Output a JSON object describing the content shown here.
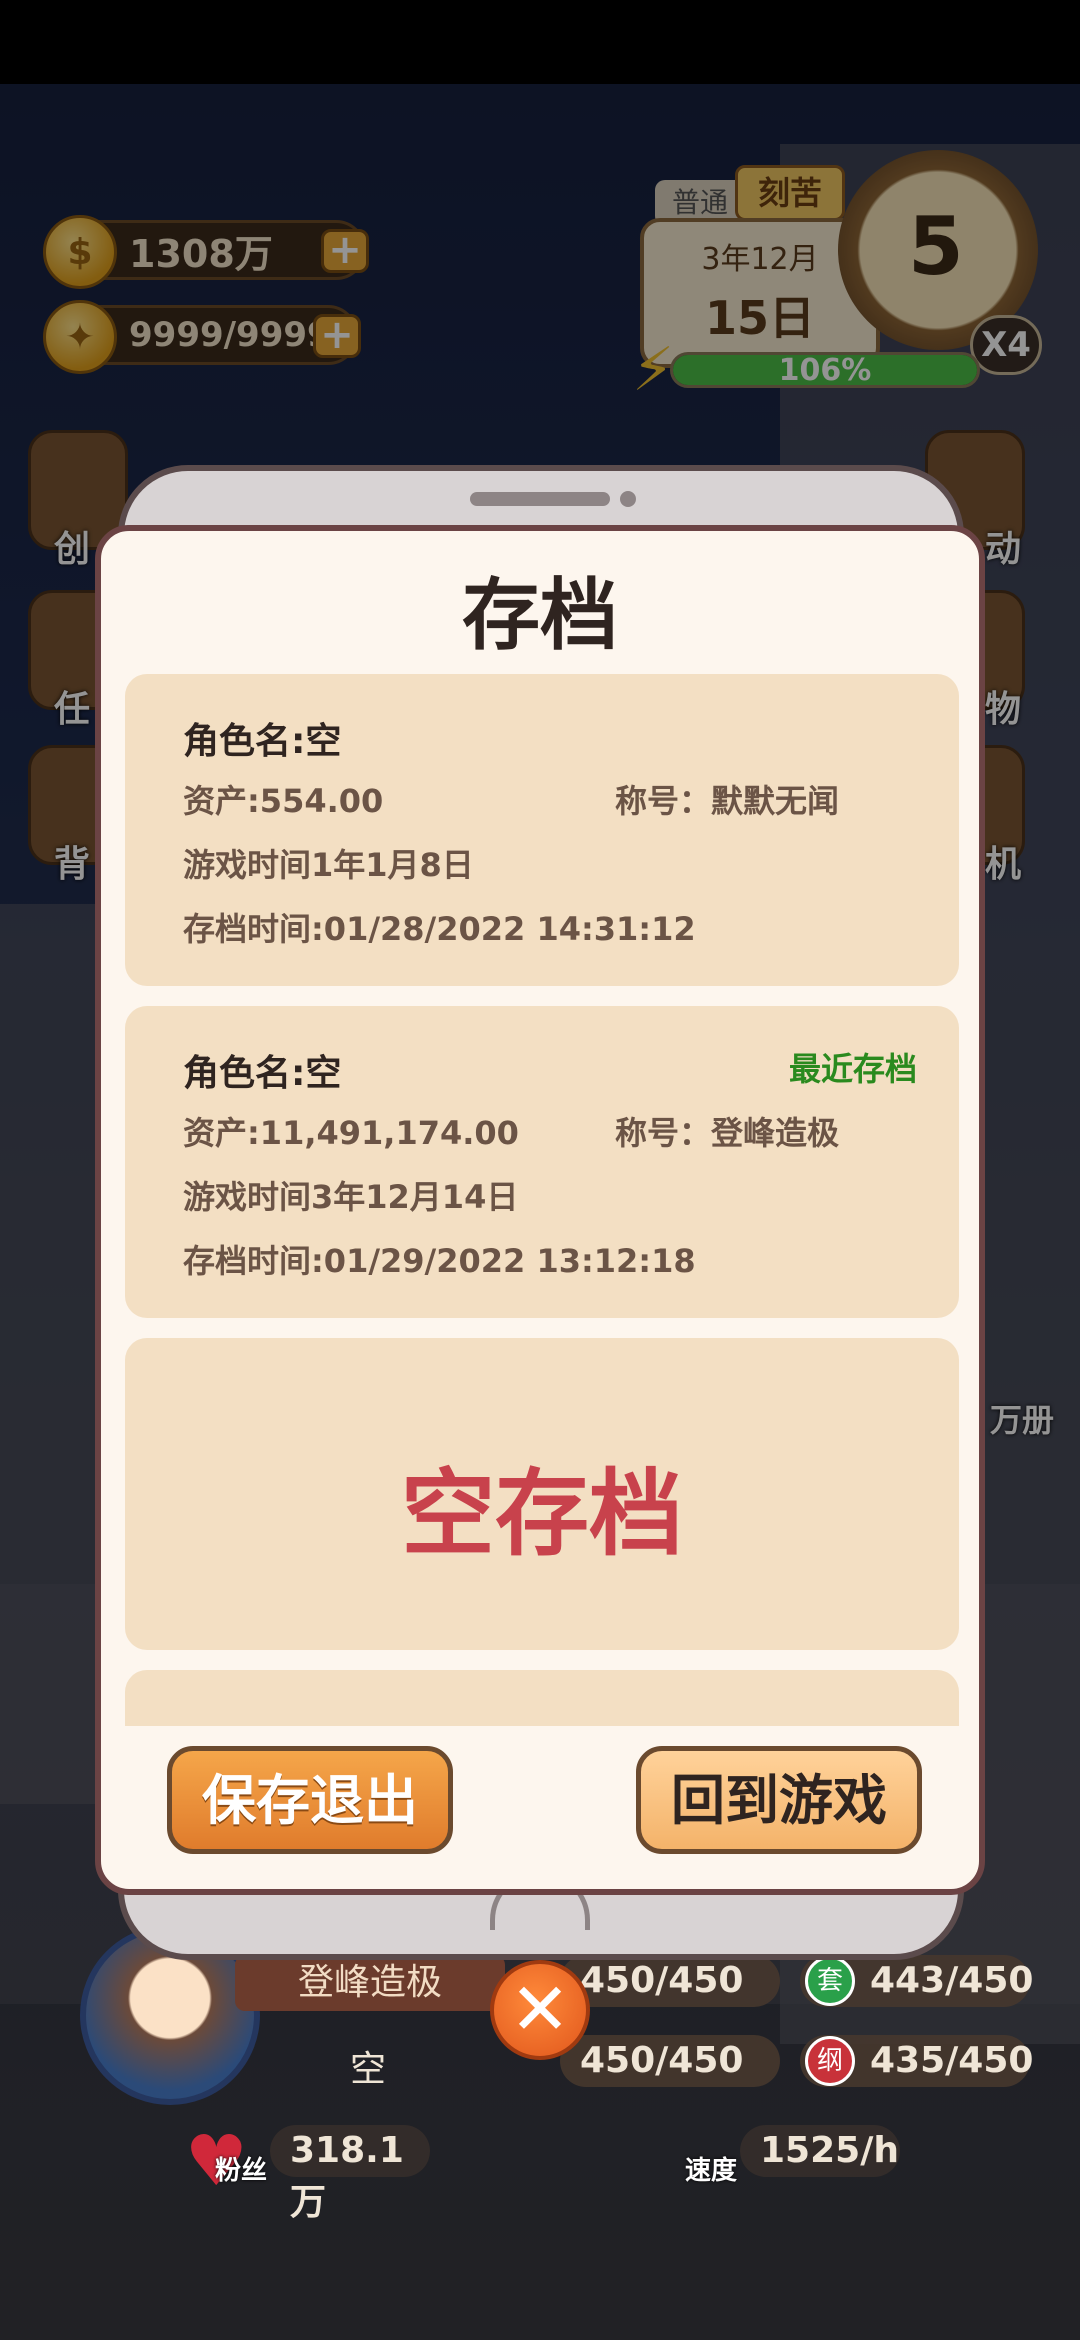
{
  "hud": {
    "money": "1308万",
    "energy_pts": "9999/9999",
    "difficulty": "刻苦",
    "mode": "普通",
    "month": "3年12月",
    "day": "15日",
    "clock_num": "5",
    "speed": "X4",
    "energy_pct": "106%",
    "energy_fraction": 1.0,
    "side_left": [
      "创",
      "任",
      "背"
    ],
    "side_right": [
      "动",
      "物",
      "机"
    ],
    "side_notice": "万册"
  },
  "bottom": {
    "title": "登峰造极",
    "name": "空",
    "stat1": "450/450",
    "stat2": "443/450",
    "stat2_icon": "套",
    "stat3": "450/450",
    "stat4": "435/450",
    "stat4_icon": "纲",
    "fans_label": "粉丝",
    "fans": "318.1万",
    "speed_label": "速度",
    "speed_val": "1525/h"
  },
  "dialog": {
    "title": "存档",
    "slots": [
      {
        "name": "角色名:空",
        "assets": "资产:554.00",
        "title": "称号：默默无闻",
        "play_time": "游戏时间1年1月8日",
        "save_time": "存档时间:01/28/2022  14:31:12",
        "recent": ""
      },
      {
        "name": "角色名:空",
        "assets": "资产:11,491,174.00",
        "title": "称号：登峰造极",
        "play_time": "游戏时间3年12月14日",
        "save_time": "存档时间:01/29/2022  13:12:18",
        "recent": "最近存档"
      }
    ],
    "empty_slot": "空存档",
    "save_quit": "保存退出",
    "back_to_game": "回到游戏"
  },
  "close_symbol": "✕"
}
